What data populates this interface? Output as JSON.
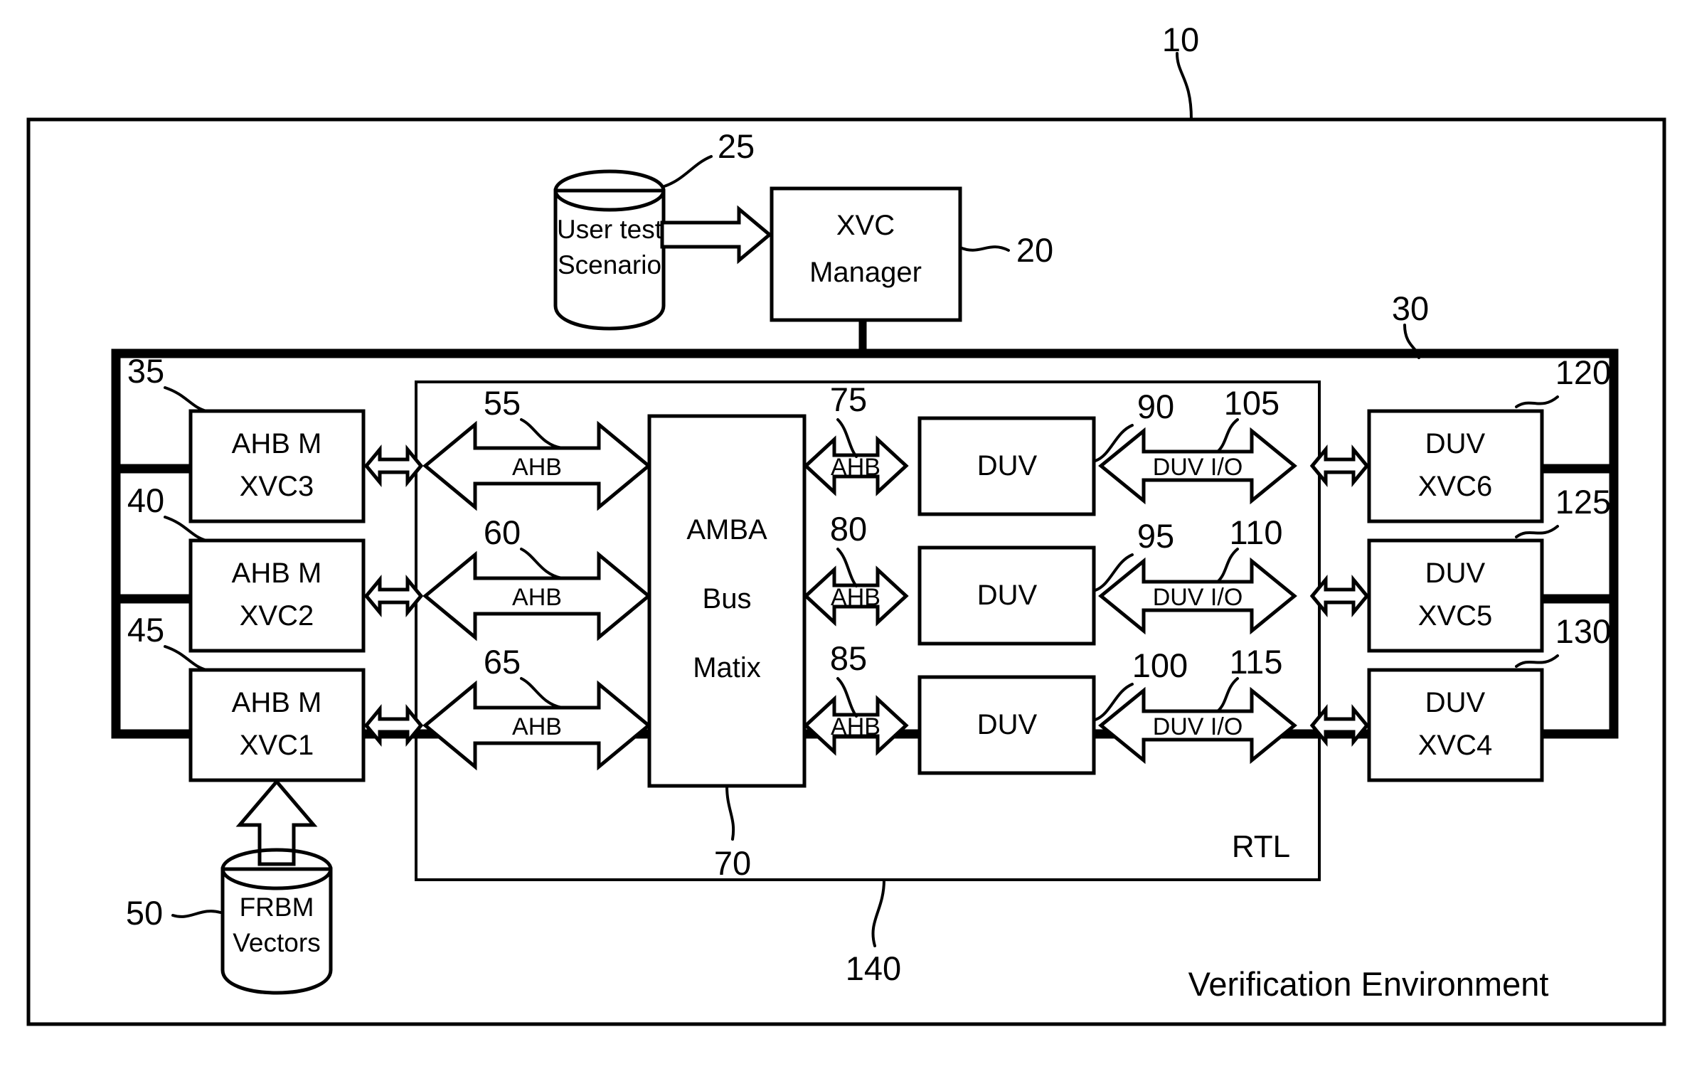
{
  "figure": {
    "outer_label": "10",
    "environment_label": "Verification Environment",
    "rtl_label": "RTL",
    "rtl_ref": "140",
    "harness_ref": "30"
  },
  "top": {
    "scenario_line1": "User test",
    "scenario_line2": "Scenario",
    "scenario_ref": "25",
    "manager_line1": "XVC",
    "manager_line2": "Manager",
    "manager_ref": "20"
  },
  "masters": [
    {
      "line1": "AHB M",
      "line2": "XVC3",
      "ref": "35"
    },
    {
      "line1": "AHB M",
      "line2": "XVC2",
      "ref": "40"
    },
    {
      "line1": "AHB M",
      "line2": "XVC1",
      "ref": "45"
    }
  ],
  "frbm": {
    "line1": "FRBM",
    "line2": "Vectors",
    "ref": "50"
  },
  "bus": {
    "line1": "AMBA",
    "line2": "Bus",
    "line3": "Matix",
    "ref": "70"
  },
  "left_buses": [
    {
      "label": "AHB",
      "ref": "55"
    },
    {
      "label": "AHB",
      "ref": "60"
    },
    {
      "label": "AHB",
      "ref": "65"
    }
  ],
  "right_buses": [
    {
      "label": "AHB",
      "ref": "75"
    },
    {
      "label": "AHB",
      "ref": "80"
    },
    {
      "label": "AHB",
      "ref": "85"
    }
  ],
  "duvs": [
    {
      "label": "DUV",
      "ref": "90"
    },
    {
      "label": "DUV",
      "ref": "95"
    },
    {
      "label": "DUV",
      "ref": "100"
    }
  ],
  "duv_io": [
    {
      "label": "DUV I/O",
      "ref": "105"
    },
    {
      "label": "DUV I/O",
      "ref": "110"
    },
    {
      "label": "DUV I/O",
      "ref": "115"
    }
  ],
  "duv_xvcs": [
    {
      "line1": "DUV",
      "line2": "XVC6",
      "ref": "120"
    },
    {
      "line1": "DUV",
      "line2": "XVC5",
      "ref": "125"
    },
    {
      "line1": "DUV",
      "line2": "XVC4",
      "ref": "130"
    }
  ],
  "colors": {
    "ink": "#000000",
    "paper": "#ffffff"
  }
}
